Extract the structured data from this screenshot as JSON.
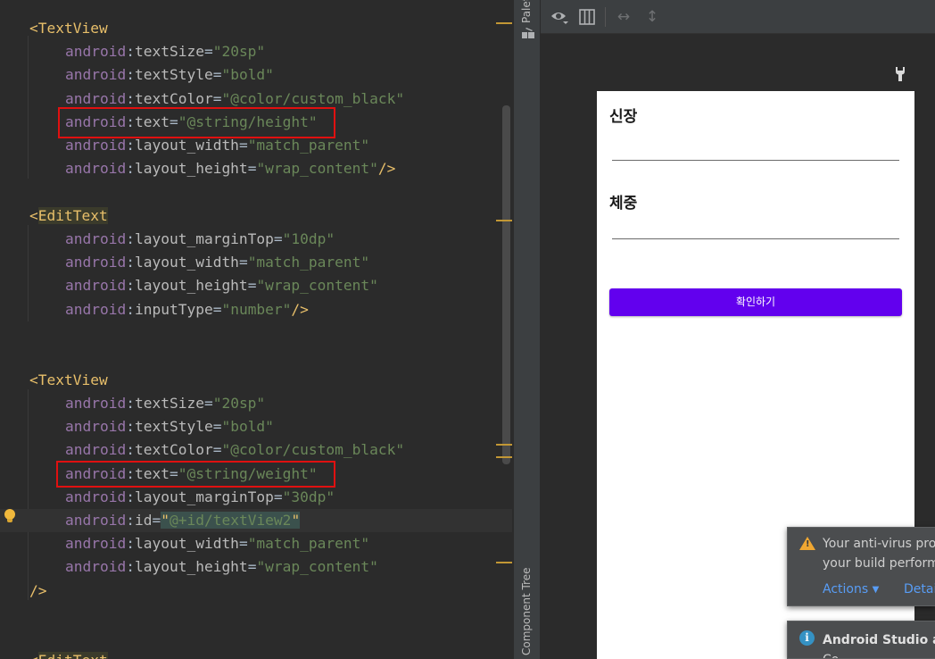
{
  "editor": {
    "lines": [
      {
        "parts": [
          [
            "bracket",
            "<"
          ],
          [
            "tag",
            "TextView"
          ]
        ]
      },
      {
        "parts": [
          [
            "ns",
            "android"
          ],
          [
            "eq",
            ":"
          ],
          [
            "attr",
            "textSize"
          ],
          [
            "eq",
            "="
          ],
          [
            "val",
            "\"20sp\""
          ]
        ]
      },
      {
        "parts": [
          [
            "ns",
            "android"
          ],
          [
            "eq",
            ":"
          ],
          [
            "attr",
            "textStyle"
          ],
          [
            "eq",
            "="
          ],
          [
            "val",
            "\"bold\""
          ]
        ]
      },
      {
        "parts": [
          [
            "ns",
            "android"
          ],
          [
            "eq",
            ":"
          ],
          [
            "attr",
            "textColor"
          ],
          [
            "eq",
            "="
          ],
          [
            "val",
            "\"@color/custom_black\""
          ]
        ]
      },
      {
        "parts": [
          [
            "ns",
            "android"
          ],
          [
            "eq",
            ":"
          ],
          [
            "attr",
            "text"
          ],
          [
            "eq",
            "="
          ],
          [
            "val",
            "\"@string/height\""
          ]
        ]
      },
      {
        "parts": [
          [
            "ns",
            "android"
          ],
          [
            "eq",
            ":"
          ],
          [
            "attr",
            "layout_width"
          ],
          [
            "eq",
            "="
          ],
          [
            "val",
            "\"match_parent\""
          ]
        ]
      },
      {
        "parts": [
          [
            "ns",
            "android"
          ],
          [
            "eq",
            ":"
          ],
          [
            "attr",
            "layout_height"
          ],
          [
            "eq",
            "="
          ],
          [
            "val",
            "\"wrap_content\""
          ],
          [
            "bracket",
            "/>"
          ]
        ]
      },
      {
        "parts": []
      },
      {
        "parts": [
          [
            "bracket",
            "<"
          ],
          [
            "taghl",
            "EditText"
          ]
        ]
      },
      {
        "parts": [
          [
            "ns",
            "android"
          ],
          [
            "eq",
            ":"
          ],
          [
            "attr",
            "layout_marginTop"
          ],
          [
            "eq",
            "="
          ],
          [
            "val",
            "\"10dp\""
          ]
        ]
      },
      {
        "parts": [
          [
            "ns",
            "android"
          ],
          [
            "eq",
            ":"
          ],
          [
            "attr",
            "layout_width"
          ],
          [
            "eq",
            "="
          ],
          [
            "val",
            "\"match_parent\""
          ]
        ]
      },
      {
        "parts": [
          [
            "ns",
            "android"
          ],
          [
            "eq",
            ":"
          ],
          [
            "attr",
            "layout_height"
          ],
          [
            "eq",
            "="
          ],
          [
            "val",
            "\"wrap_content\""
          ]
        ]
      },
      {
        "parts": [
          [
            "ns",
            "android"
          ],
          [
            "eq",
            ":"
          ],
          [
            "attr",
            "inputType"
          ],
          [
            "eq",
            "="
          ],
          [
            "val",
            "\"number\""
          ],
          [
            "bracket",
            "/>"
          ]
        ]
      },
      {
        "parts": []
      },
      {
        "parts": []
      },
      {
        "parts": [
          [
            "bracket",
            "<"
          ],
          [
            "tag",
            "TextView"
          ]
        ]
      },
      {
        "parts": [
          [
            "ns",
            "android"
          ],
          [
            "eq",
            ":"
          ],
          [
            "attr",
            "textSize"
          ],
          [
            "eq",
            "="
          ],
          [
            "val",
            "\"20sp\""
          ]
        ]
      },
      {
        "parts": [
          [
            "ns",
            "android"
          ],
          [
            "eq",
            ":"
          ],
          [
            "attr",
            "textStyle"
          ],
          [
            "eq",
            "="
          ],
          [
            "val",
            "\"bold\""
          ]
        ]
      },
      {
        "parts": [
          [
            "ns",
            "android"
          ],
          [
            "eq",
            ":"
          ],
          [
            "attr",
            "textColor"
          ],
          [
            "eq",
            "="
          ],
          [
            "val",
            "\"@color/custom_black\""
          ]
        ]
      },
      {
        "parts": [
          [
            "ns",
            "android"
          ],
          [
            "eq",
            ":"
          ],
          [
            "attr",
            "text"
          ],
          [
            "eq",
            "="
          ],
          [
            "val",
            "\"@string/weight\""
          ]
        ]
      },
      {
        "parts": [
          [
            "ns",
            "android"
          ],
          [
            "eq",
            ":"
          ],
          [
            "attr",
            "layout_marginTop"
          ],
          [
            "eq",
            "="
          ],
          [
            "val",
            "\"30dp\""
          ]
        ]
      },
      {
        "parts": [
          [
            "ns",
            "android"
          ],
          [
            "eq",
            ":"
          ],
          [
            "attr",
            "id"
          ],
          [
            "eq",
            "="
          ],
          [
            "quotehl",
            "\""
          ],
          [
            "valhl",
            "@+id/textView2"
          ],
          [
            "quotehl",
            "\""
          ]
        ]
      },
      {
        "parts": [
          [
            "ns",
            "android"
          ],
          [
            "eq",
            ":"
          ],
          [
            "attr",
            "layout_width"
          ],
          [
            "eq",
            "="
          ],
          [
            "val",
            "\"match_parent\""
          ]
        ]
      },
      {
        "parts": [
          [
            "ns",
            "android"
          ],
          [
            "eq",
            ":"
          ],
          [
            "attr",
            "layout_height"
          ],
          [
            "eq",
            "="
          ],
          [
            "val",
            "\"wrap_content\""
          ]
        ]
      },
      {
        "parts": [
          [
            "bracket",
            "/>"
          ]
        ]
      },
      {
        "parts": []
      },
      {
        "parts": []
      },
      {
        "parts": [
          [
            "bracket",
            "<"
          ],
          [
            "taghl",
            "EditText"
          ]
        ]
      }
    ]
  },
  "side_strip": {
    "palette_label": "Palette",
    "component_tree_label": "Component Tree"
  },
  "design_toolbar": {
    "icons": [
      "eye-icon",
      "blueprint-icon",
      "horizontal-resize-icon",
      "vertical-resize-icon"
    ]
  },
  "preview": {
    "height_label": "신장",
    "weight_label": "체중",
    "confirm_button": "확인하기",
    "button_color": "#6200ee"
  },
  "notifications": {
    "antivirus": {
      "line1": "Your anti-virus pro",
      "line2": "your build perform",
      "actions_link": "Actions",
      "details_link": "Detai"
    },
    "android_studio": {
      "title": "Android Studio an",
      "line2": "Co"
    }
  }
}
